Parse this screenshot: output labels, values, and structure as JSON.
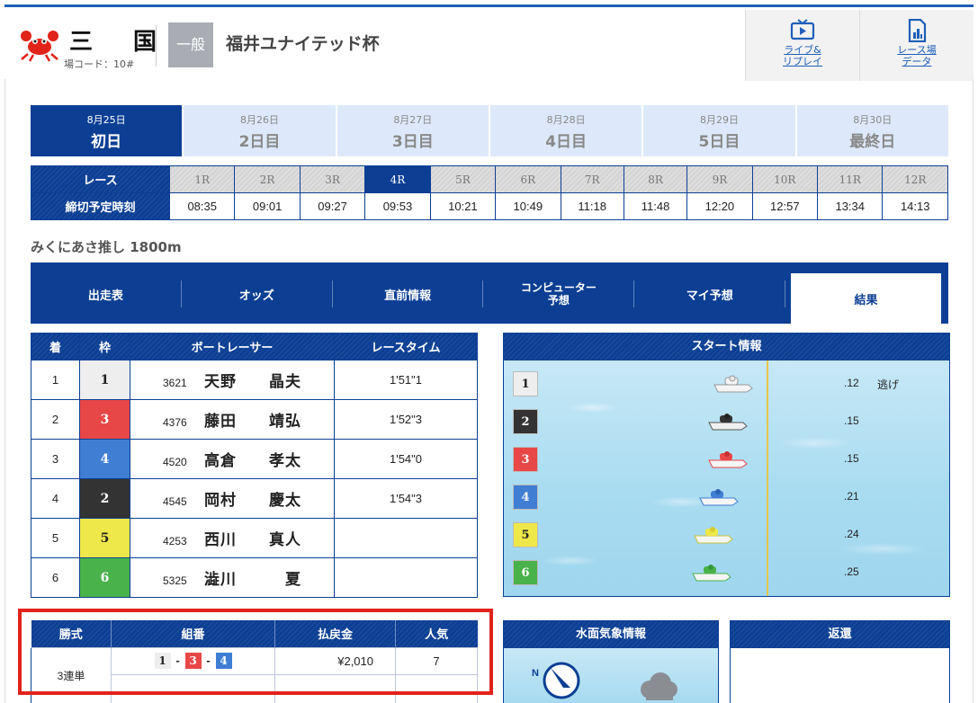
{
  "header": {
    "venue": "三 国",
    "venue_code": "場コード：10#",
    "grade": "一般",
    "race_title": "福井ユナイテッド杯",
    "live_label_1": "ライブ&",
    "live_label_2": "リプレイ",
    "data_label_1": "レース場",
    "data_label_2": "データ"
  },
  "days": [
    {
      "date": "8月25日",
      "label": "初日"
    },
    {
      "date": "8月26日",
      "label": "2日目"
    },
    {
      "date": "8月27日",
      "label": "3日目"
    },
    {
      "date": "8月28日",
      "label": "4日目"
    },
    {
      "date": "8月29日",
      "label": "5日目"
    },
    {
      "date": "8月30日",
      "label": "最終日"
    }
  ],
  "schedule": {
    "race_label": "レース",
    "time_label": "締切予定時刻",
    "races": [
      "1R",
      "2R",
      "3R",
      "4R",
      "5R",
      "6R",
      "7R",
      "8R",
      "9R",
      "10R",
      "11R",
      "12R"
    ],
    "times": [
      "08:35",
      "09:01",
      "09:27",
      "09:53",
      "10:21",
      "10:49",
      "11:18",
      "11:48",
      "12:20",
      "12:57",
      "13:34",
      "14:13"
    ]
  },
  "race_name": "みくにあさ推し 1800m",
  "tabs": {
    "t1": "出走表",
    "t2": "オッズ",
    "t3": "直前情報",
    "t4a": "コンピューター",
    "t4b": "予想",
    "t5": "マイ予想",
    "t6": "結果"
  },
  "results": {
    "headers": {
      "rank": "着",
      "waku": "枠",
      "racer": "ボートレーサー",
      "time": "レースタイム"
    },
    "rows": [
      {
        "rank": "1",
        "waku": "1",
        "reg": "3621",
        "name": "天野　　晶夫",
        "time": "1'51\"1"
      },
      {
        "rank": "2",
        "waku": "3",
        "reg": "4376",
        "name": "藤田　　靖弘",
        "time": "1'52\"3"
      },
      {
        "rank": "3",
        "waku": "4",
        "reg": "4520",
        "name": "高倉　　孝太",
        "time": "1'54\"0"
      },
      {
        "rank": "4",
        "waku": "2",
        "reg": "4545",
        "name": "岡村　　慶太",
        "time": "1'54\"3"
      },
      {
        "rank": "5",
        "waku": "5",
        "reg": "4253",
        "name": "西川　　真人",
        "time": ""
      },
      {
        "rank": "6",
        "waku": "6",
        "reg": "5325",
        "name": "澁川　　　夏",
        "time": ""
      }
    ]
  },
  "start_info": {
    "title": "スタート情報",
    "rows": [
      {
        "waku": "1",
        "st": ".12",
        "kimarite": "逃げ"
      },
      {
        "waku": "2",
        "st": ".15",
        "kimarite": ""
      },
      {
        "waku": "3",
        "st": ".15",
        "kimarite": ""
      },
      {
        "waku": "4",
        "st": ".21",
        "kimarite": ""
      },
      {
        "waku": "5",
        "st": ".24",
        "kimarite": ""
      },
      {
        "waku": "6",
        "st": ".25",
        "kimarite": ""
      }
    ]
  },
  "payout": {
    "headers": {
      "kind": "勝式",
      "combo": "組番",
      "amount": "払戻金",
      "pop": "人気"
    },
    "kind": "3連単",
    "combo": [
      "1",
      "3",
      "4"
    ],
    "amount": "¥2,010",
    "popularity": "7"
  },
  "weather_title": "水面気象情報",
  "weather_compass": "N",
  "refund_title": "返還",
  "colors": {
    "navy": "#0c3f94",
    "waku1": "#eeeeee",
    "waku2": "#333333",
    "waku3": "#e84747",
    "waku4": "#3f7ed3",
    "waku5": "#eee84a",
    "waku6": "#49b24a"
  }
}
